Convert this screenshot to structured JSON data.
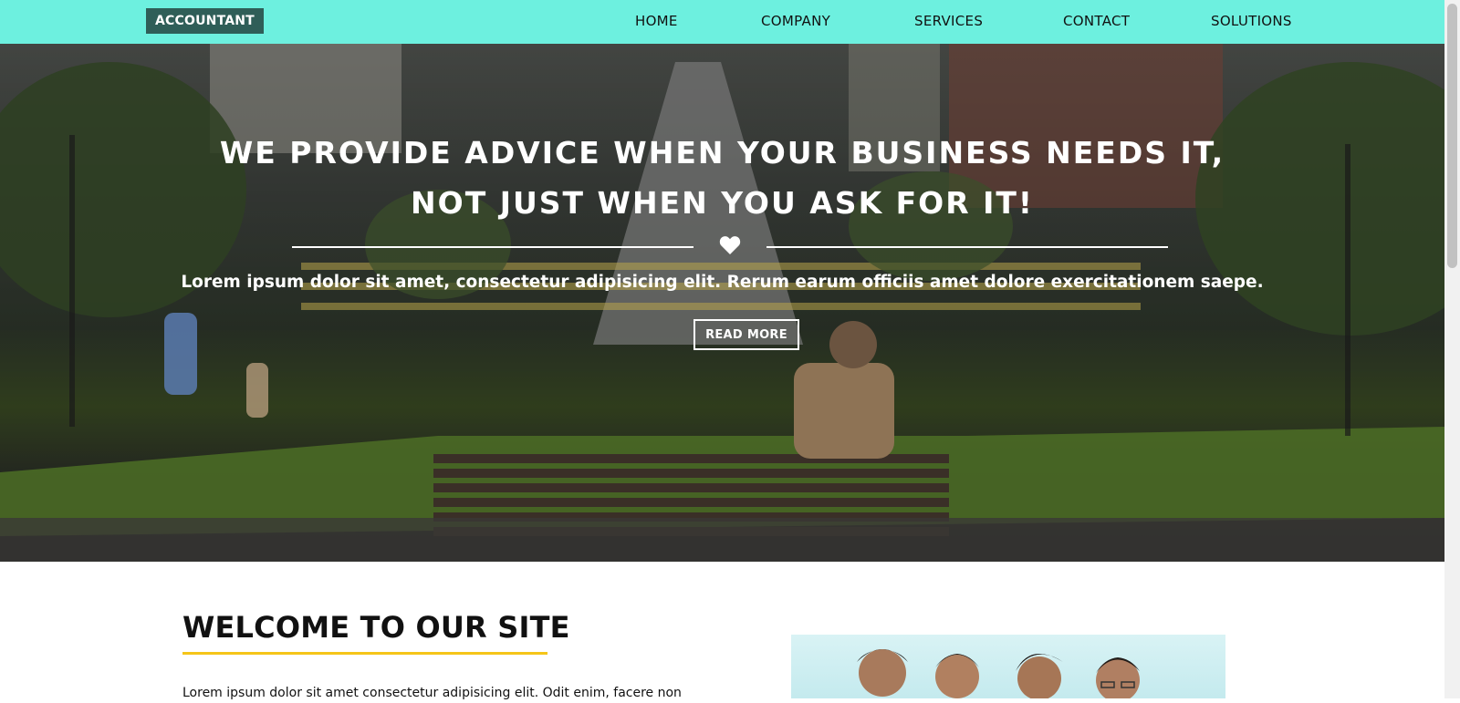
{
  "nav": {
    "logo": "ACCOUNTANT",
    "items": [
      "HOME",
      "COMPANY",
      "SERVICES",
      "CONTACT",
      "SOLUTIONS"
    ],
    "bg_color": "#6df0df",
    "logo_bg_color": "#2f5e58"
  },
  "hero": {
    "title_line1": "WE PROVIDE ADVICE WHEN YOUR BUSINESS NEEDS IT,",
    "title_line2": "NOT JUST WHEN YOU ASK FOR IT!",
    "divider_icon": "heart-icon",
    "subtitle": "Lorem ipsum dolor sit amet, consectetur adipisicing elit. Rerum earum officiis amet dolore exercitationem saepe.",
    "button_label": "READ MORE"
  },
  "welcome": {
    "title": "WELCOME TO OUR SITE",
    "text": "Lorem ipsum dolor sit amet consectetur adipisicing elit. Odit enim, facere non",
    "underline_color": "#f5c518"
  }
}
